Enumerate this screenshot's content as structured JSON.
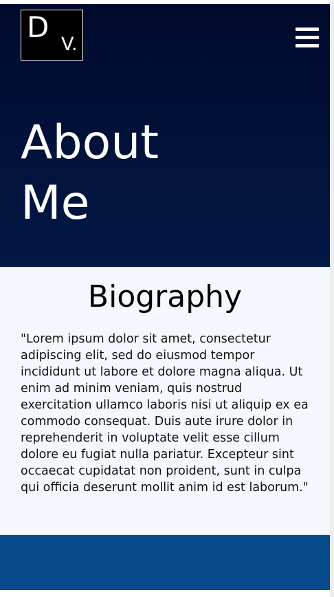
{
  "header": {
    "logo_letter": "D",
    "logo_suffix": "V.",
    "title": "About Me"
  },
  "bio": {
    "title": "Biography",
    "text": "\"Lorem ipsum dolor sit amet, consectetur adipiscing elit, sed do eiusmod tempor incididunt ut labore et dolore magna aliqua. Ut enim ad minim veniam, quis nostrud exercitation ullamco laboris nisi ut aliquip ex ea commodo consequat. Duis aute irure dolor in reprehenderit in voluptate velit esse cillum dolore eu fugiat nulla pariatur. Excepteur sint occaecat cupidatat non proident, sunt in culpa qui officia deserunt mollit anim id est laborum.\""
  },
  "icons": {
    "menu": "hamburger-menu-icon"
  },
  "colors": {
    "hero_top": "#000a2c",
    "hero_bottom": "#031846",
    "bio_background": "#f4f8fe",
    "footer": "#064a8c"
  }
}
